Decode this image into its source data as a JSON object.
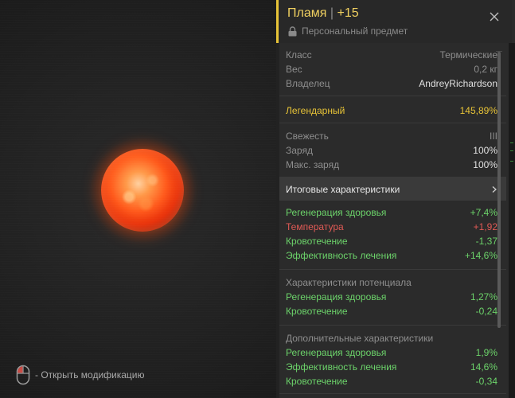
{
  "viewer": {
    "hint_text": "- Открыть модификацию"
  },
  "item": {
    "name": "Пламя",
    "separator": "|",
    "upgrade": "+15",
    "subtitle": "Персональный предмет"
  },
  "basic": [
    {
      "label": "Класс",
      "value": "Термические"
    },
    {
      "label": "Вес",
      "value": "0,2 кг"
    },
    {
      "label": "Владелец",
      "value": "AndreyRichardson"
    }
  ],
  "legendary": {
    "label": "Легендарный",
    "value": "145,89%"
  },
  "power": [
    {
      "label": "Свежесть",
      "value": "III"
    },
    {
      "label": "Заряд",
      "value": "100%"
    },
    {
      "label": "Макс. заряд",
      "value": "100%"
    }
  ],
  "summary": {
    "label": "Итоговые характеристики"
  },
  "totals": [
    {
      "label": "Регенерация здоровья",
      "value": "+7,4%",
      "tone": "green"
    },
    {
      "label": "Температура",
      "value": "+1,92",
      "tone": "red"
    },
    {
      "label": "Кровотечение",
      "value": "-1,37",
      "tone": "green"
    },
    {
      "label": "Эффективность лечения",
      "value": "+14,6%",
      "tone": "green"
    }
  ],
  "potential": {
    "title": "Характеристики потенциала",
    "rows": [
      {
        "label": "Регенерация здоровья",
        "value": "1,27%"
      },
      {
        "label": "Кровотечение",
        "value": "-0,24"
      }
    ]
  },
  "extra": {
    "title": "Дополнительные характеристики",
    "rows": [
      {
        "label": "Регенерация здоровья",
        "value": "1,9%"
      },
      {
        "label": "Эффективность лечения",
        "value": "14,6%"
      },
      {
        "label": "Кровотечение",
        "value": "-0,34"
      }
    ]
  },
  "colors": {
    "accent": "#e8c437",
    "positive": "#6cd36a",
    "negative": "#e05a55",
    "panel": "#2b2b2b"
  },
  "icons": [
    "mouse-icon",
    "lock-icon",
    "close-icon",
    "chevron-right-icon"
  ]
}
